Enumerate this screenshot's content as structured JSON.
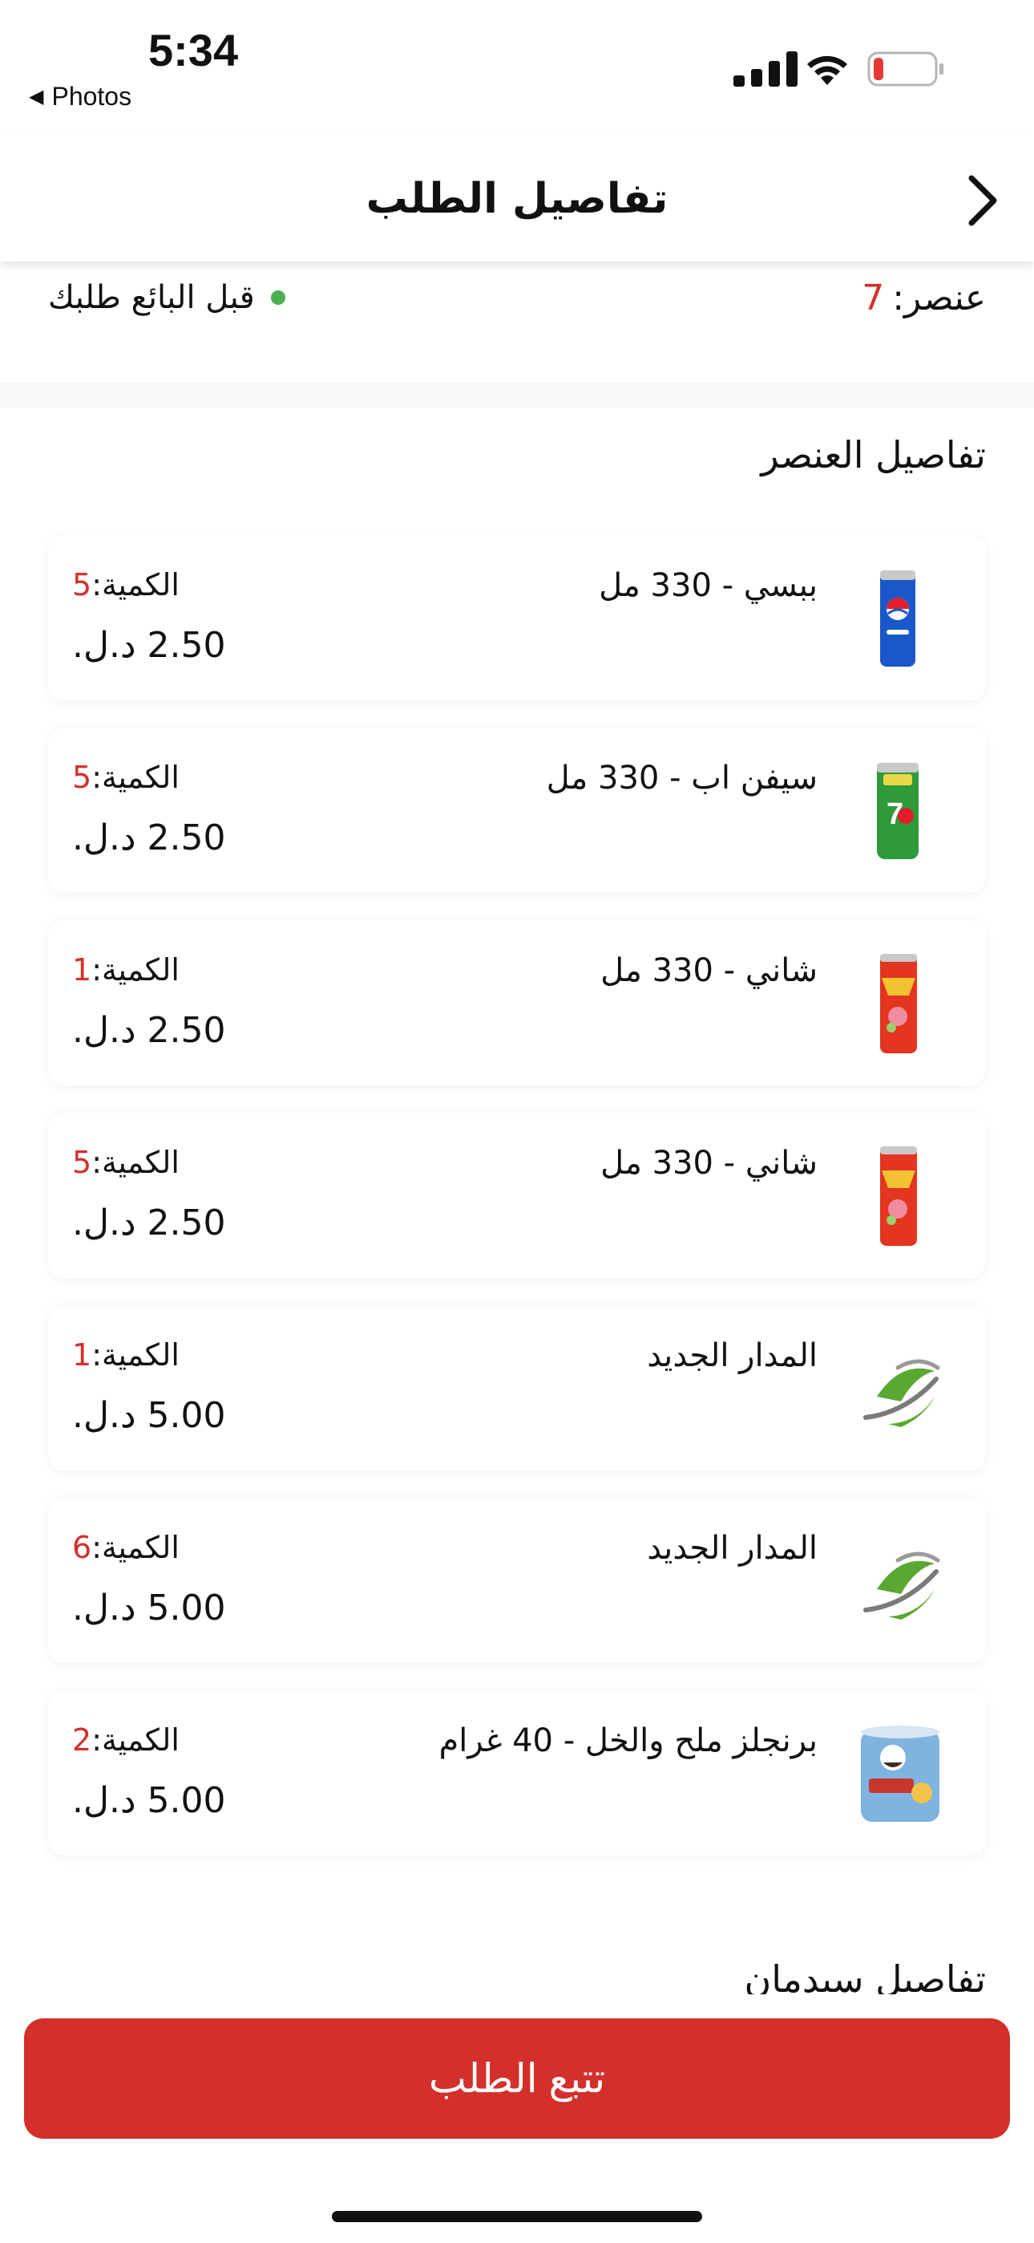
{
  "status_bar": {
    "time": "5:34",
    "back_app": "Photos"
  },
  "nav": {
    "title": "تفاصيل الطلب"
  },
  "summary": {
    "items_label": "عنصر:",
    "items_count": "7",
    "status_text": "قبل البائع طلبك",
    "status_color": "#4caf50"
  },
  "section_title": "تفاصيل العنصر",
  "qty_label": "الكمية:",
  "items": [
    {
      "name": "ببسي - 330 مل",
      "qty": "5",
      "price": "2.50 د.ل.",
      "icon": "pepsi-can-icon"
    },
    {
      "name": "سيفن اب - 330 مل",
      "qty": "5",
      "price": "2.50 د.ل.",
      "icon": "7up-can-icon"
    },
    {
      "name": "شاني - 330 مل",
      "qty": "1",
      "price": "2.50 د.ل.",
      "icon": "shani-can-icon"
    },
    {
      "name": "شاني - 330 مل",
      "qty": "5",
      "price": "2.50 د.ل.",
      "icon": "shani-can-icon"
    },
    {
      "name": "المدار الجديد",
      "qty": "1",
      "price": "5.00 د.ل.",
      "icon": "almadar-logo-icon"
    },
    {
      "name": "المدار الجديد",
      "qty": "6",
      "price": "5.00 د.ل.",
      "icon": "almadar-logo-icon"
    },
    {
      "name": "برنجلز ملح والخل - 40 غرام",
      "qty": "2",
      "price": "5.00 د.ل.",
      "icon": "pringles-can-icon"
    }
  ],
  "next_section_title": "تفاصيل سيدمان",
  "track_button": "تتبع الطلب",
  "colors": {
    "accent": "#d3302b",
    "quantity": "#d4302b"
  }
}
